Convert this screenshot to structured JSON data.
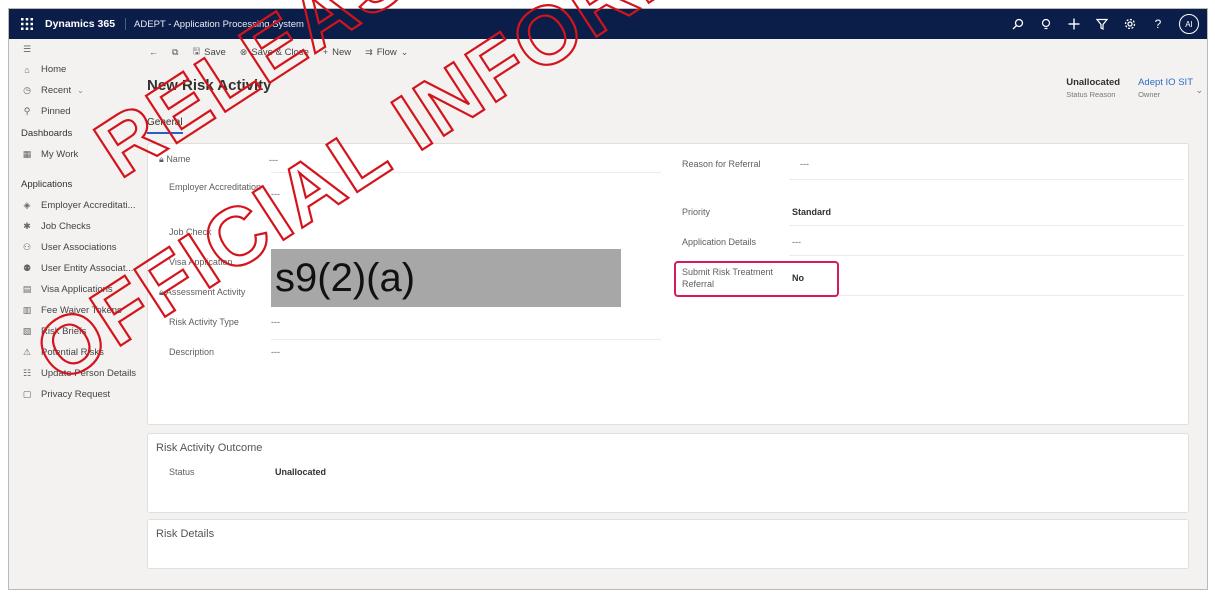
{
  "topbar": {
    "brand": "Dynamics 365",
    "app_name": "ADEPT - Application Processing System",
    "avatar_initials": "AI",
    "icons": [
      "search-icon",
      "lightbulb-icon",
      "plus-icon",
      "filter-icon",
      "settings-icon",
      "help-icon"
    ]
  },
  "nav": {
    "home": "Home",
    "recent": "Recent",
    "pinned": "Pinned",
    "dashboards_header": "Dashboards",
    "my_work": "My Work",
    "applications_header": "Applications",
    "items": [
      "Employer Accreditati...",
      "Job Checks",
      "User Associations",
      "User Entity Associat...",
      "Visa Applications",
      "Fee Waiver Tokens",
      "Risk Briefs",
      "Potential Risks",
      "Update Person Details",
      "Privacy Request"
    ]
  },
  "commands": {
    "save": "Save",
    "save_close": "Save & Close",
    "new": "New",
    "flow": "Flow"
  },
  "form": {
    "title": "New Risk Activity",
    "status_reason_value": "Unallocated",
    "status_reason_label": "Status Reason",
    "owner_value": "Adept IO SIT",
    "owner_label": "Owner",
    "tab_general": "General"
  },
  "general_left": {
    "name_label": "Name",
    "name_value": "---",
    "employer_accreditation_label": "Employer Accreditation",
    "employer_accreditation_value": "---",
    "job_check_label": "Job Check",
    "visa_application_label": "Visa Application",
    "assessment_activity_label": "Assessment Activity",
    "risk_activity_type_label": "Risk Activity Type",
    "risk_activity_type_value": "---",
    "description_label": "Description",
    "description_value": "---"
  },
  "general_right": {
    "reason_for_referral_label": "Reason for Referral",
    "reason_for_referral_value": "---",
    "priority_label": "Priority",
    "priority_value": "Standard",
    "application_details_label": "Application Details",
    "application_details_value": "---",
    "submit_risk_label": "Submit Risk Treatment Referral",
    "submit_risk_value": "No"
  },
  "redaction": {
    "text": "s9(2)(a)"
  },
  "outcome": {
    "section_title": "Risk Activity Outcome",
    "status_label": "Status",
    "status_value": "Unallocated"
  },
  "risk_details": {
    "section_title": "Risk Details"
  },
  "watermark": {
    "line1": "RELEASED UNDER",
    "line2": "OFFICIAL INFORMATION"
  },
  "colors": {
    "topbar": "#0b1e49",
    "highlight": "#d61a5e",
    "watermark": "#d4141c",
    "link": "#2b6cc4"
  }
}
